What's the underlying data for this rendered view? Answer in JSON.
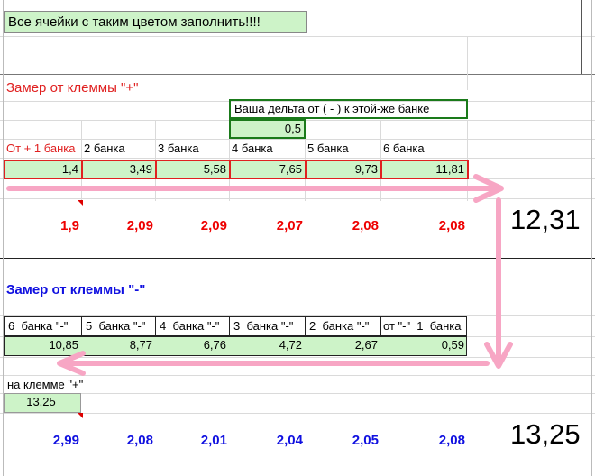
{
  "notice": "Все ячейки с таким цветом заполнить!!!!",
  "plus_section": {
    "title": "Замер от клеммы \"+\"",
    "delta_label": "Ваша дельта от ( - ) к этой-же банке",
    "delta_value": "0,5",
    "headers": [
      "От + 1 банка",
      "2 банка",
      "3 банка",
      "4 банка",
      "5 банка",
      "6 банка"
    ],
    "values": [
      "1,4",
      "3,49",
      "5,58",
      "7,65",
      "9,73",
      "11,81"
    ],
    "results": [
      "1,9",
      "2,09",
      "2,09",
      "2,07",
      "2,08",
      "2,08"
    ],
    "total": "12,31"
  },
  "minus_section": {
    "title": "Замер от клеммы \"-\"",
    "headers": [
      "6  банка \"-\"",
      "5  банка \"-\"",
      "4  банка \"-\"",
      "3  банка \"-\"",
      "2  банка \"-\"",
      "от \"-\"  1  банка"
    ],
    "values": [
      "10,85",
      "8,77",
      "6,76",
      "4,72",
      "2,67",
      "0,59"
    ],
    "plus_label": "на клемме \"+\"",
    "plus_value": "13,25",
    "results": [
      "2,99",
      "2,08",
      "2,01",
      "2,04",
      "2,05",
      "2,08"
    ],
    "total": "13,25"
  },
  "colors": {
    "input_fill": "#cdf3c8",
    "arrow": "#f7a6c4",
    "red_border": "#e02020",
    "green_border": "#1a7a1a"
  }
}
